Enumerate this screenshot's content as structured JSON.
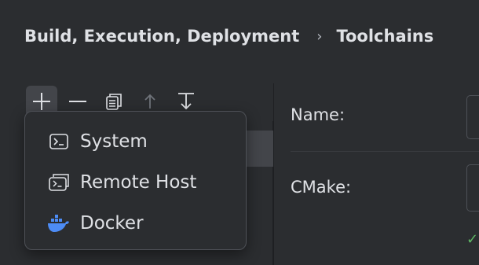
{
  "breadcrumb": {
    "parent": "Build, Execution, Deployment",
    "separator": "›",
    "current": "Toolchains"
  },
  "toolbar": {
    "buttons": [
      {
        "icon": "plus-icon"
      },
      {
        "icon": "minus-icon"
      },
      {
        "icon": "copy-icon"
      },
      {
        "icon": "arrow-up-icon"
      },
      {
        "icon": "arrow-down-icon"
      }
    ]
  },
  "form": {
    "name_label": "Name:",
    "cmake_label": "CMake:",
    "cmake_status": "✓"
  },
  "add_menu": {
    "items": [
      {
        "label": "System",
        "icon": "terminal-icon"
      },
      {
        "label": "Remote Host",
        "icon": "remote-terminal-icon"
      },
      {
        "label": "Docker",
        "icon": "docker-icon"
      }
    ]
  },
  "colors": {
    "background": "#2b2d30",
    "text": "#dfe1e5",
    "accent_docker": "#4d8cf5",
    "success": "#5fb865"
  }
}
